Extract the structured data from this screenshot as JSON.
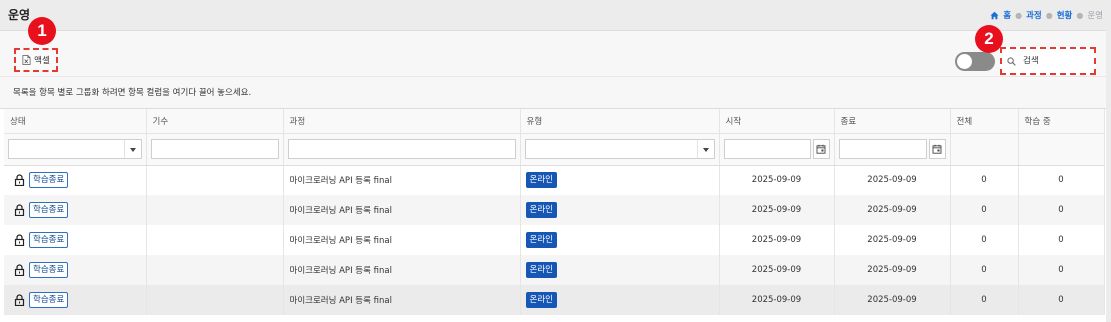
{
  "page": {
    "title": "운영",
    "breadcrumb": [
      {
        "label": "홈",
        "current": false
      },
      {
        "label": "과정",
        "current": false
      },
      {
        "label": "현황",
        "current": false
      },
      {
        "label": "운영",
        "current": true
      }
    ]
  },
  "toolbar": {
    "excel_label": "액셀",
    "badge_1": "1",
    "badge_2": "2",
    "search_placeholder": "검색",
    "toggle_on": false
  },
  "group_hint": "목록을 항목 별로 그룹화 하려면 항목 컬럼을 여기다 끌어 놓으세요.",
  "table": {
    "columns": [
      "상태",
      "기수",
      "과정",
      "유형",
      "시작",
      "종료",
      "전체",
      "학습 중"
    ],
    "rows": [
      {
        "status": "학습종료",
        "round": "",
        "course": "마이크로러닝 API 등록 final",
        "type": "온라인",
        "start": "2025-09-09",
        "end": "2025-09-09",
        "total": "0",
        "learning": "0"
      },
      {
        "status": "학습종료",
        "round": "",
        "course": "마이크로러닝 API 등록 final",
        "type": "온라인",
        "start": "2025-09-09",
        "end": "2025-09-09",
        "total": "0",
        "learning": "0"
      },
      {
        "status": "학습종료",
        "round": "",
        "course": "마이크로러닝 API 등록 final",
        "type": "온라인",
        "start": "2025-09-09",
        "end": "2025-09-09",
        "total": "0",
        "learning": "0"
      },
      {
        "status": "학습종료",
        "round": "",
        "course": "마이크로러닝 API 등록 final",
        "type": "온라인",
        "start": "2025-09-09",
        "end": "2025-09-09",
        "total": "0",
        "learning": "0"
      },
      {
        "status": "학습종료",
        "round": "",
        "course": "마이크로러닝 API 등록 final",
        "type": "온라인",
        "start": "2025-09-09",
        "end": "2025-09-09",
        "total": "0",
        "learning": "0"
      }
    ]
  },
  "colors": {
    "accent": "#1a6fd6",
    "badge_red": "#e8101d",
    "type_badge": "#1656b5"
  },
  "icons": {
    "home": "home-icon",
    "excel": "excel-file-icon",
    "search": "search-icon",
    "lock": "lock-icon",
    "calendar": "calendar-icon"
  }
}
